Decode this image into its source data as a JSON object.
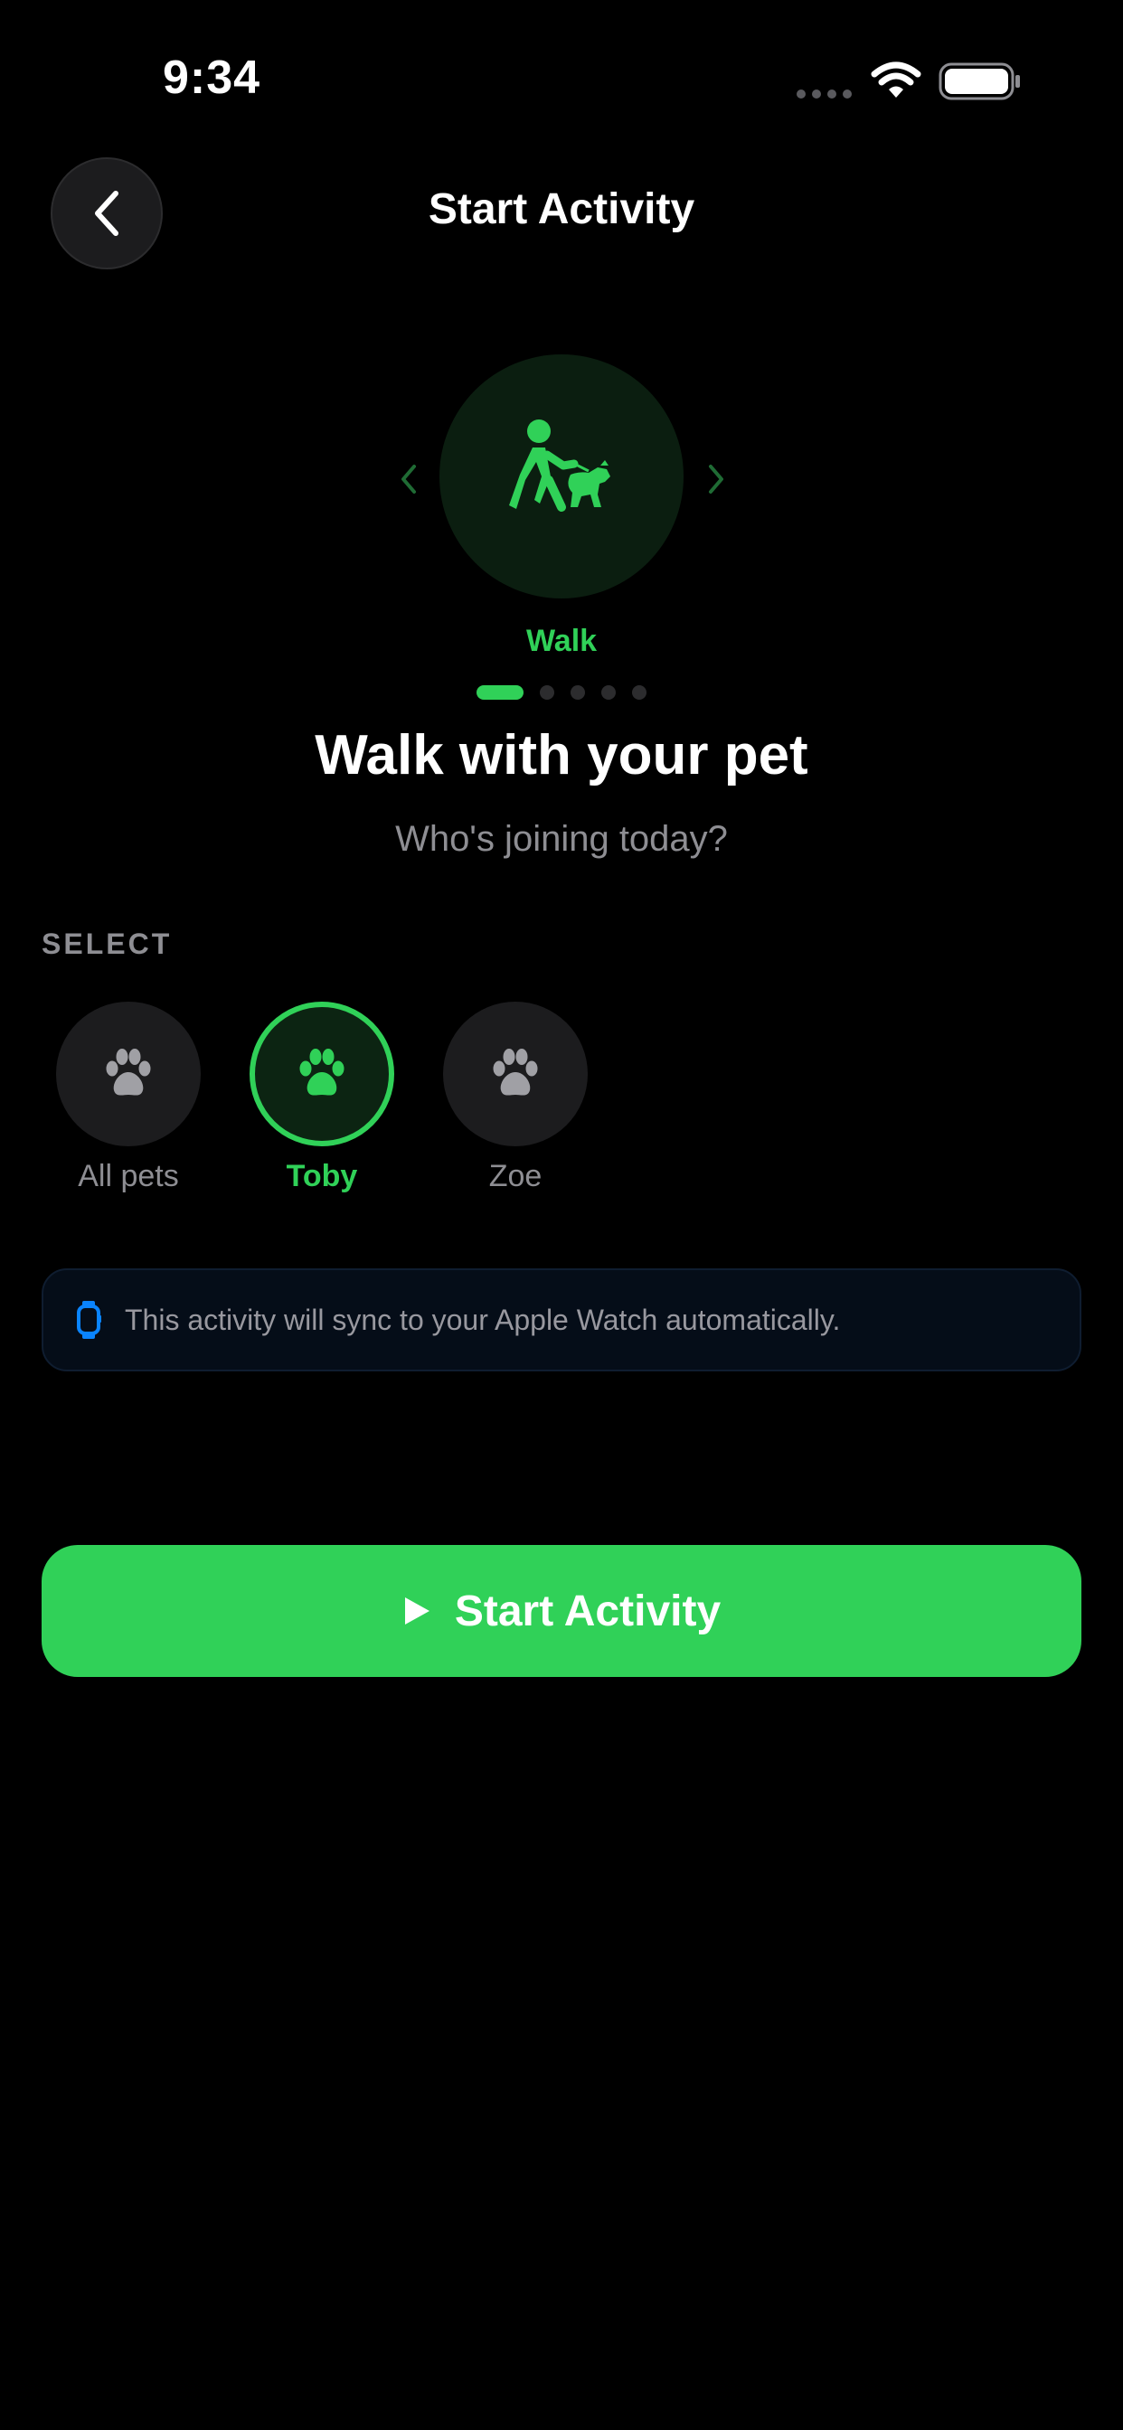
{
  "status_bar": {
    "time": "9:34"
  },
  "header": {
    "title": "Start Activity"
  },
  "activity": {
    "current_label": "Walk",
    "page_count": 5,
    "current_page": 1,
    "headline": "Walk with your pet",
    "subheadline": "Who's joining today?"
  },
  "pet_select": {
    "section_label": "SELECT",
    "options": [
      {
        "label": "All pets",
        "selected": false
      },
      {
        "label": "Toby",
        "selected": true
      },
      {
        "label": "Zoe",
        "selected": false
      }
    ]
  },
  "info_banner": {
    "text": "This activity will sync to your Apple Watch automatically."
  },
  "start_button": {
    "label": "Start Activity"
  },
  "colors": {
    "accent": "#30d158",
    "background": "#000000",
    "secondary_text": "#8e8e93",
    "watch_blue": "#0a84ff"
  },
  "icons": {
    "back": "chevron-left-icon",
    "prev": "chevron-left-icon",
    "next": "chevron-right-icon",
    "activity": "person-walking-dog-icon",
    "pet": "paw-icon",
    "watch": "apple-watch-icon",
    "play": "play-icon"
  }
}
